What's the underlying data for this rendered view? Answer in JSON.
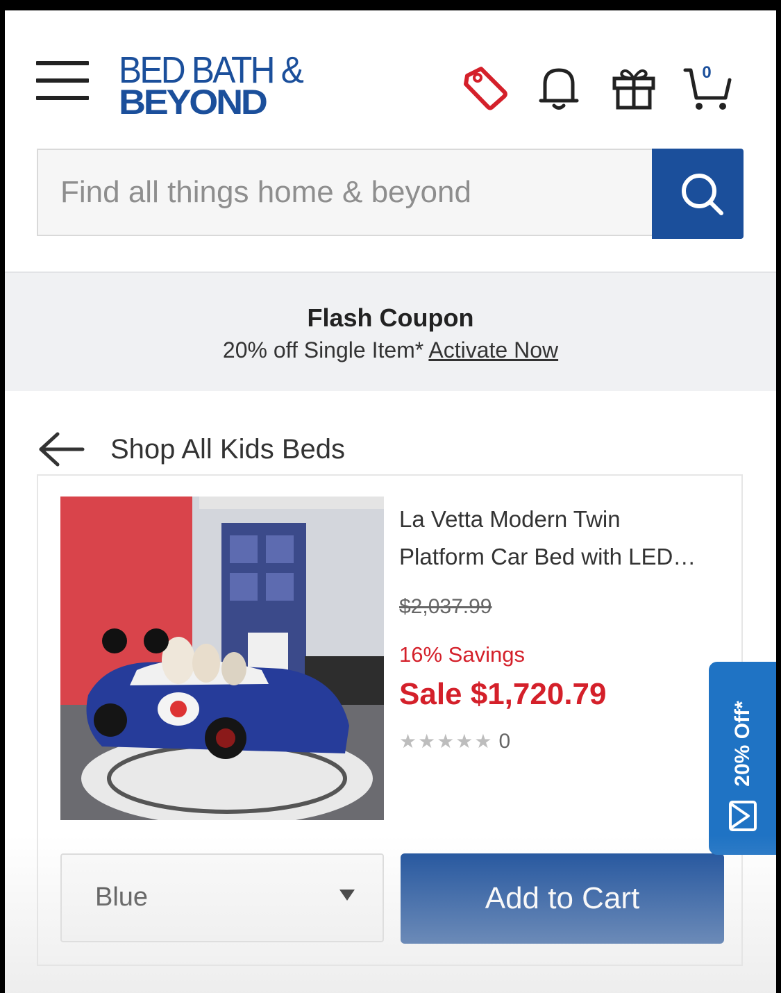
{
  "header": {
    "menu_icon": "hamburger-menu-icon",
    "logo_line1": "BED BATH &",
    "logo_line2": "BEYOND",
    "icons": [
      "tag-icon",
      "bell-icon",
      "gift-icon",
      "cart-icon"
    ],
    "cart_count": "0",
    "brand_color": "#1b4f9b",
    "tag_color": "#d4202a"
  },
  "search": {
    "placeholder": "Find all things home & beyond",
    "button_icon": "search-icon"
  },
  "coupon": {
    "title": "Flash Coupon",
    "text": "20% off Single Item*",
    "link": "Activate Now"
  },
  "back": {
    "icon": "arrow-left-icon",
    "label": "Shop All Kids Beds"
  },
  "product": {
    "name_line1": "La Vetta Modern Twin",
    "name_line2": "Platform Car Bed with LED…",
    "was_price": "$2,037.99",
    "savings": "16% Savings",
    "sale_price": "Sale $1,720.79",
    "rating_stars": "★★★★★",
    "rating_count": "0",
    "rating_value": 0,
    "color_selected": "Blue",
    "add_to_cart": "Add to Cart",
    "sale_color": "#d4202a"
  },
  "offer_tab": {
    "label": "20% Off*",
    "icon": "envelope-icon",
    "color": "#1f73c4"
  }
}
